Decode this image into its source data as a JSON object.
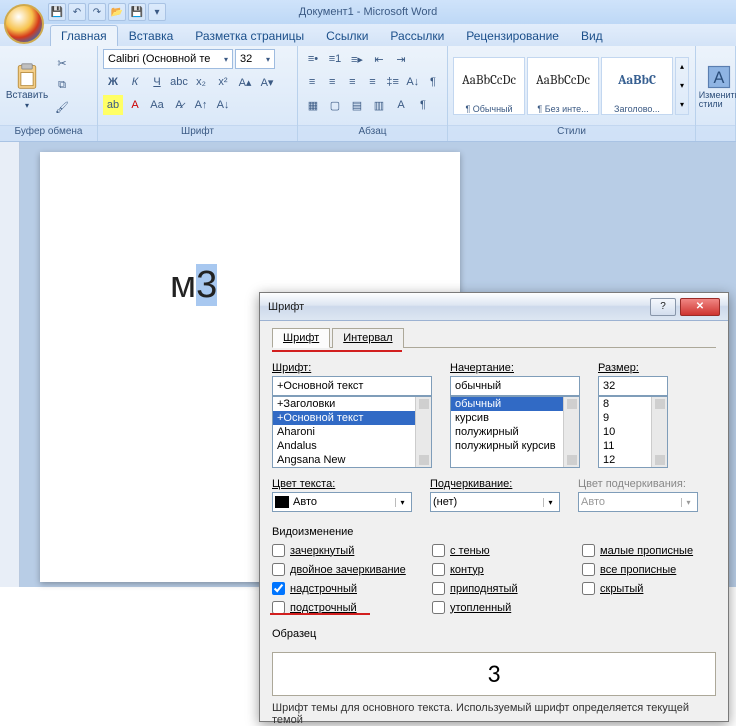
{
  "app": {
    "title": "Документ1 - Microsoft Word"
  },
  "ribbon_tabs": [
    "Главная",
    "Вставка",
    "Разметка страницы",
    "Ссылки",
    "Рассылки",
    "Рецензирование",
    "Вид"
  ],
  "clipboard": {
    "paste": "Вставить",
    "group": "Буфер обмена"
  },
  "font": {
    "group": "Шрифт",
    "name": "Calibri (Основной те",
    "size": "32"
  },
  "paragraph": {
    "group": "Абзац"
  },
  "styles": {
    "group": "Стили",
    "items": [
      {
        "preview": "AaBbCcDc",
        "label": "¶ Обычный"
      },
      {
        "preview": "AaBbCcDc",
        "label": "¶ Без инте..."
      },
      {
        "preview": "AaBbC",
        "label": "Заголово..."
      }
    ],
    "change": "Изменить стили"
  },
  "document": {
    "m": "м",
    "three": "3"
  },
  "dialog": {
    "title": "Шрифт",
    "tabs": [
      "Шрифт",
      "Интервал"
    ],
    "labels": {
      "font": "Шрифт:",
      "style": "Начертание:",
      "size": "Размер:",
      "color": "Цвет текста:",
      "underline": "Подчеркивание:",
      "ucolor": "Цвет подчеркивания:",
      "effects": "Видоизменение",
      "sample": "Образец"
    },
    "font_input": "+Основной текст",
    "font_list": [
      "+Заголовки",
      "+Основной текст",
      "Aharoni",
      "Andalus",
      "Angsana New"
    ],
    "style_input": "обычный",
    "style_list": [
      "обычный",
      "курсив",
      "полужирный",
      "полужирный курсив"
    ],
    "size_input": "32",
    "size_list": [
      "8",
      "9",
      "10",
      "11",
      "12"
    ],
    "color": "Авто",
    "underline": "(нет)",
    "ucolor": "Авто",
    "effects": [
      [
        "зачеркнутый",
        "с тенью",
        "малые прописные"
      ],
      [
        "двойное зачеркивание",
        "контур",
        "все прописные"
      ],
      [
        "надстрочный",
        "приподнятый",
        "скрытый"
      ],
      [
        "подстрочный",
        "утопленный",
        ""
      ]
    ],
    "checked": "надстрочный",
    "sample_text": "3",
    "footer": "Шрифт темы для основного текста. Используемый шрифт определяется текущей темой"
  }
}
